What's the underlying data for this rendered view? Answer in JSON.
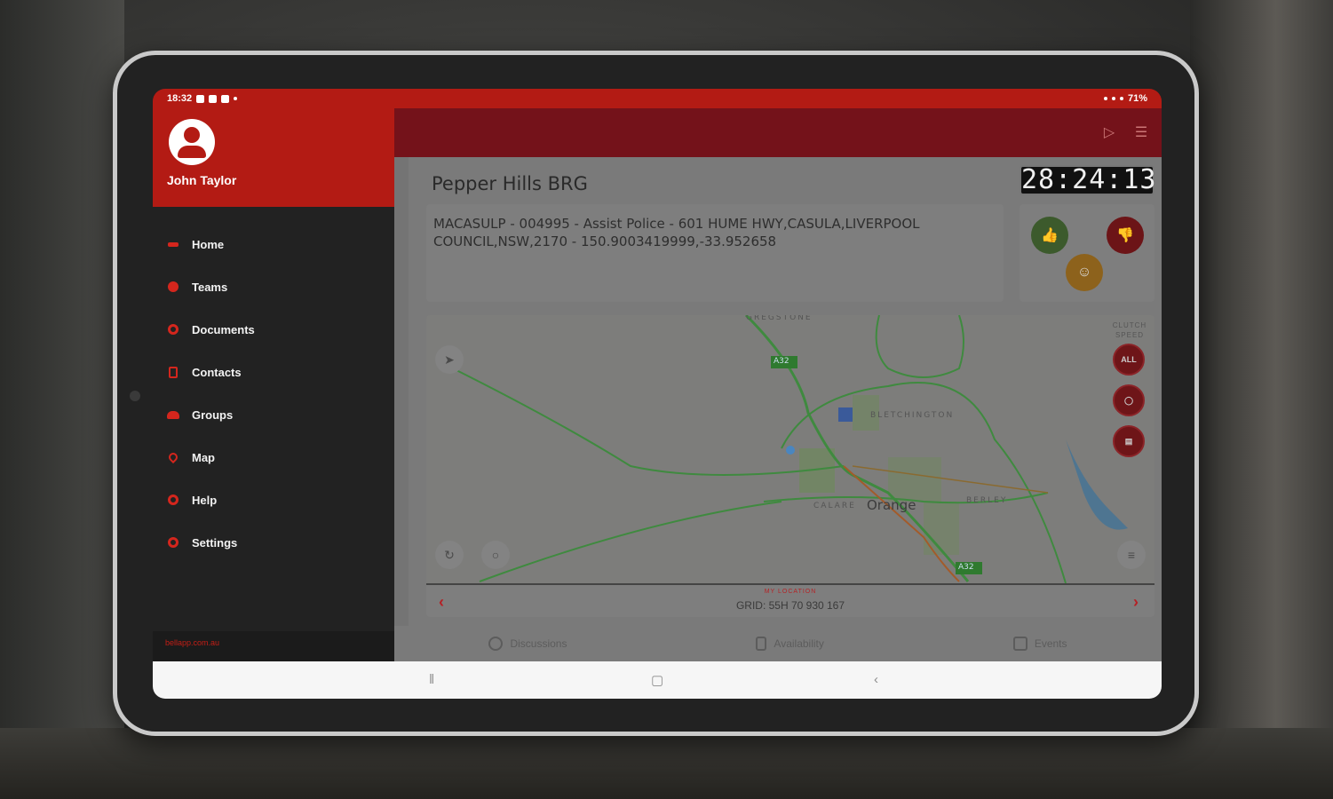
{
  "status_bar": {
    "time": "18:32",
    "battery": "71%"
  },
  "drawer": {
    "user_name": "John Taylor",
    "items": [
      {
        "label": "Home",
        "icon": "home-icon"
      },
      {
        "label": "Teams",
        "icon": "teams-icon"
      },
      {
        "label": "Documents",
        "icon": "documents-icon"
      },
      {
        "label": "Contacts",
        "icon": "contacts-icon"
      },
      {
        "label": "Groups",
        "icon": "groups-icon"
      },
      {
        "label": "Map",
        "icon": "map-pin-icon"
      },
      {
        "label": "Help",
        "icon": "help-icon"
      },
      {
        "label": "Settings",
        "icon": "settings-icon"
      }
    ],
    "footer": "bellapp.com.au"
  },
  "toolbar": {
    "play_icon": "play-circle-icon",
    "menu_icon": "menu-icon"
  },
  "event": {
    "title": "Pepper Hills BRG",
    "timer": "28:24:13",
    "description": "MACASULP - 004995 - Assist Police - 601 HUME HWY,CASULA,LIVERPOOL COUNCIL,NSW,2170 - 150.9003419999,-33.952658"
  },
  "response_buttons": {
    "yes_icon": "thumbs-up-icon",
    "no_icon": "thumbs-down-icon",
    "maybe_icon": "neutral-face-icon"
  },
  "map": {
    "labels": {
      "city": "Orange",
      "suburb_1": "BLETCHINGTON",
      "suburb_2": "BERLEY",
      "suburb_3": "CALARE",
      "suburb_top": "GREGSTONE",
      "road_shield_1": "A32",
      "road_shield_2": "A32"
    },
    "filter_title": "CLUTCH SPEED",
    "filters": [
      "ALL",
      "",
      ""
    ],
    "grid_caption": "MY LOCATION",
    "grid_value": "GRID: 55H 70 930 167"
  },
  "bottom_tabs": [
    {
      "label": "Discussions",
      "icon": "chat-icon"
    },
    {
      "label": "Availability",
      "icon": "phone-icon"
    },
    {
      "label": "Events",
      "icon": "calendar-icon"
    }
  ],
  "colors": {
    "brand_red": "#b31b14",
    "dark_red": "#74121a",
    "drawer_bg": "#222222"
  }
}
